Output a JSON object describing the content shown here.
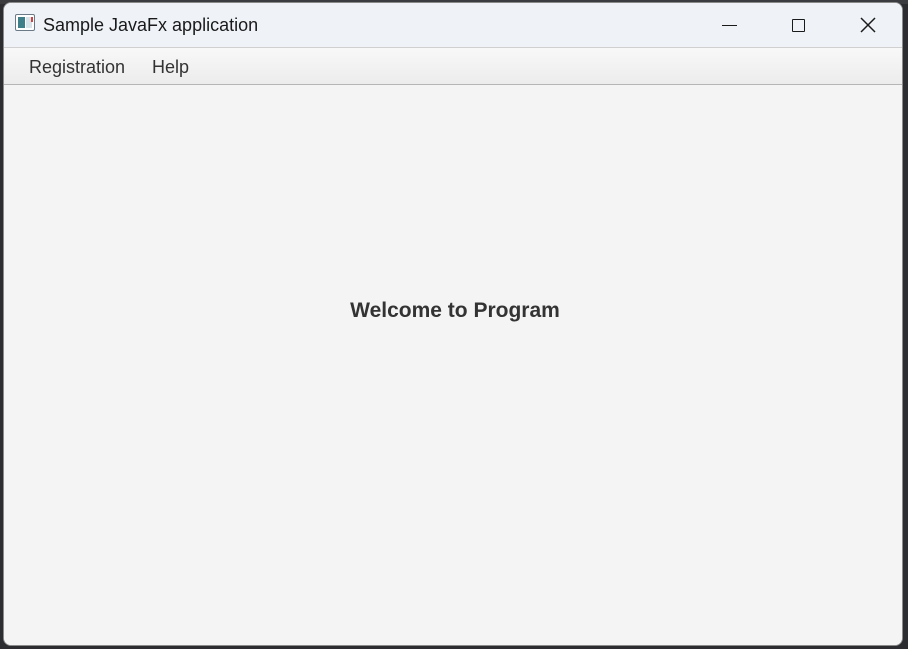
{
  "window": {
    "title": "Sample JavaFx application",
    "controls": {
      "minimize": "minimize-icon",
      "maximize": "maximize-icon",
      "close": "close-icon"
    }
  },
  "menubar": {
    "items": [
      {
        "label": "Registration"
      },
      {
        "label": "Help"
      }
    ]
  },
  "main": {
    "welcome_text": "Welcome to Program"
  },
  "colors": {
    "titlebar_bg": "#eff3f8",
    "content_bg": "#f4f4f4",
    "text": "#333333"
  }
}
